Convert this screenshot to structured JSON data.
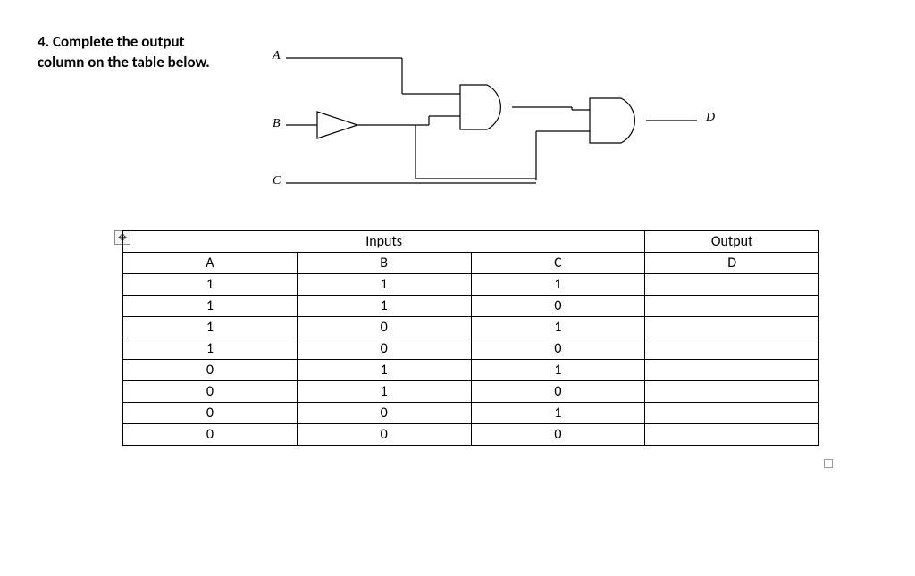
{
  "question": {
    "line1": "4. Complete the output",
    "line2": "column on the table below."
  },
  "circuit": {
    "labelA": "A",
    "labelB": "B",
    "labelC": "C",
    "labelD": "D"
  },
  "table": {
    "headerInputs": "Inputs",
    "headerOutput": "Output",
    "colA": "A",
    "colB": "B",
    "colC": "C",
    "colD": "D",
    "rows": [
      {
        "A": "1",
        "B": "1",
        "C": "1",
        "D": ""
      },
      {
        "A": "1",
        "B": "1",
        "C": "0",
        "D": ""
      },
      {
        "A": "1",
        "B": "0",
        "C": "1",
        "D": ""
      },
      {
        "A": "1",
        "B": "0",
        "C": "0",
        "D": ""
      },
      {
        "A": "0",
        "B": "1",
        "C": "1",
        "D": ""
      },
      {
        "A": "0",
        "B": "1",
        "C": "0",
        "D": ""
      },
      {
        "A": "0",
        "B": "0",
        "C": "1",
        "D": ""
      },
      {
        "A": "0",
        "B": "0",
        "C": "0",
        "D": ""
      }
    ]
  },
  "icons": {
    "move": "✥"
  }
}
